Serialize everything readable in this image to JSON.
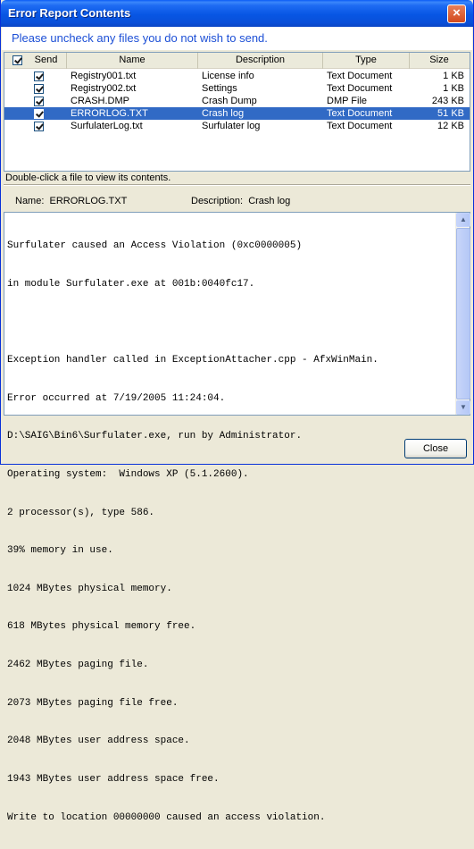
{
  "window": {
    "title": "Error Report Contents"
  },
  "header": {
    "instruction": "Please uncheck any files you do not wish to send."
  },
  "columns": {
    "send": "Send",
    "name": "Name",
    "description": "Description",
    "type": "Type",
    "size": "Size"
  },
  "files": [
    {
      "name": "Registry001.txt",
      "description": "License info",
      "type": "Text Document",
      "size": "1 KB",
      "checked": true
    },
    {
      "name": "Registry002.txt",
      "description": "Settings",
      "type": "Text Document",
      "size": "1 KB",
      "checked": true
    },
    {
      "name": "CRASH.DMP",
      "description": "Crash Dump",
      "type": "DMP File",
      "size": "243 KB",
      "checked": true
    },
    {
      "name": "ERRORLOG.TXT",
      "description": "Crash log",
      "type": "Text Document",
      "size": "51 KB",
      "checked": true,
      "selected": true
    },
    {
      "name": "SurfulaterLog.txt",
      "description": "Surfulater log",
      "type": "Text Document",
      "size": "12 KB",
      "checked": true
    }
  ],
  "hint": "Double-click a file to view its contents.",
  "selected_file": {
    "name_label": "Name:",
    "name": "ERRORLOG.TXT",
    "description_label": "Description:",
    "description": "Crash log"
  },
  "log_lines": [
    "Surfulater caused an Access Violation (0xc0000005)",
    "in module Surfulater.exe at 001b:0040fc17.",
    "",
    "Exception handler called in ExceptionAttacher.cpp - AfxWinMain.",
    "Error occurred at 7/19/2005 11:24:04.",
    "D:\\SAIG\\Bin6\\Surfulater.exe, run by Administrator.",
    "Operating system:  Windows XP (5.1.2600).",
    "2 processor(s), type 586.",
    "39% memory in use.",
    "1024 MBytes physical memory.",
    "618 MBytes physical memory free.",
    "2462 MBytes paging file.",
    "2073 MBytes paging file free.",
    "2048 MBytes user address space.",
    "1943 MBytes user address space free.",
    "Write to location 00000000 caused an access violation."
  ],
  "buttons": {
    "close": "Close",
    "title_close": "×"
  },
  "colors": {
    "title_bar": "#0756e4",
    "selection": "#316ac5",
    "instruction_text": "#1c4fd6"
  },
  "icons": {
    "scroll_up": "▲",
    "scroll_down": "▼"
  }
}
